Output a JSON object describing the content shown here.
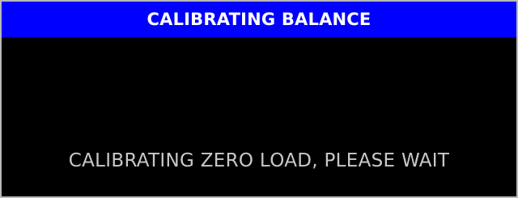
{
  "window": {
    "title": "CALIBRATING BALANCE"
  },
  "status": {
    "message": "CALIBRATING ZERO LOAD, PLEASE WAIT"
  },
  "colors": {
    "title_bar_background": "#0000ff",
    "title_text": "#ffffff",
    "content_background": "#000000",
    "message_text": "#c8c8c8",
    "border": "#b8b8b8"
  }
}
